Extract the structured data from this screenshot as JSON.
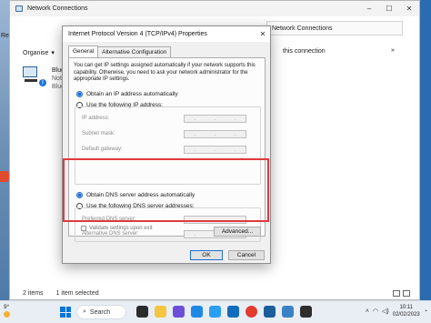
{
  "desktop": {
    "left_letter": "Re"
  },
  "explorer": {
    "title": "Network Connections",
    "address_right": "Network Connections",
    "toolbar": {
      "organise": "Organise",
      "rename": "this connection",
      "more": "»"
    },
    "adapter": {
      "line1": "Blue",
      "line2": "Not",
      "line3": "Blue"
    },
    "status": {
      "items": "2 items",
      "selected": "1 item selected"
    }
  },
  "dialog": {
    "title": "Internet Protocol Version 4 (TCP/IPv4) Properties",
    "tabs": [
      "General",
      "Alternative Configuration"
    ],
    "intro": "You can get IP settings assigned automatically if your network supports this capability. Otherwise, you need to ask your network administrator for the appropriate IP settings.",
    "ip_auto": "Obtain an IP address automatically",
    "ip_manual": "Use the following IP address:",
    "ip_fields": [
      "IP address:",
      "Subnet mask:",
      "Default gateway:"
    ],
    "dns_auto": "Obtain DNS server address automatically",
    "dns_manual": "Use the following DNS server addresses:",
    "dns_fields": [
      "Preferred DNS server:",
      "Alternative DNS server:"
    ],
    "validate": "Validate settings upon exit",
    "advanced": "Advanced...",
    "ok": "OK",
    "cancel": "Cancel"
  },
  "taskbar": {
    "weather_temp": "9°",
    "search": "Search",
    "time": "10:11",
    "date": "02/02/2023"
  },
  "colors": {
    "highlight": "#e03a3e",
    "accent": "#1f6dd1"
  }
}
